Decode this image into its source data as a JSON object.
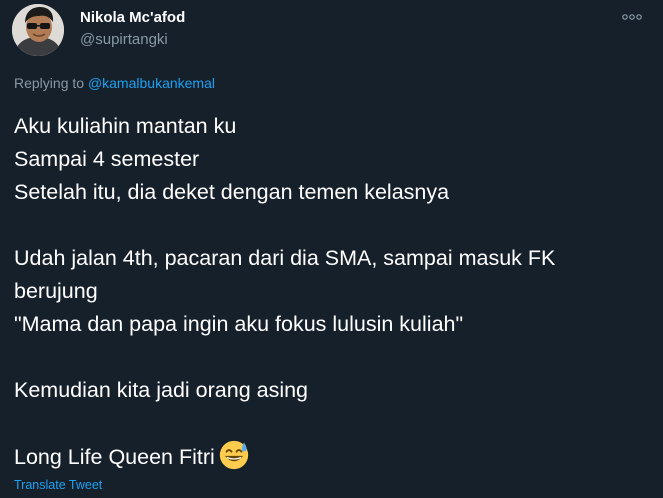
{
  "author": {
    "display_name": "Nikola Mc'afod",
    "handle": "@supirtangki",
    "avatar_icon": "profile-photo"
  },
  "more_icon": "more-options-icon",
  "reply": {
    "prefix": "Replying to ",
    "mention": "@kamalbukankemal"
  },
  "body": {
    "line1": "Aku kuliahin mantan ku",
    "line2": "Sampai 4 semester",
    "line3": "Setelah itu, dia deket dengan temen kelasnya",
    "line4": "Udah jalan 4th, pacaran dari dia SMA, sampai masuk FK",
    "line5": "berujung",
    "line6": "\"Mama dan papa ingin aku fokus lulusin kuliah\"",
    "line7": "Kemudian kita jadi orang asing",
    "line8": "Long Life Queen Fitri",
    "emoji_name": "grinning-face-with-sweat-emoji"
  },
  "translate_label": "Translate Tweet",
  "colors": {
    "background": "#16202b",
    "text": "#ffffff",
    "secondary": "#8899a6",
    "accent": "#1da1f2"
  }
}
